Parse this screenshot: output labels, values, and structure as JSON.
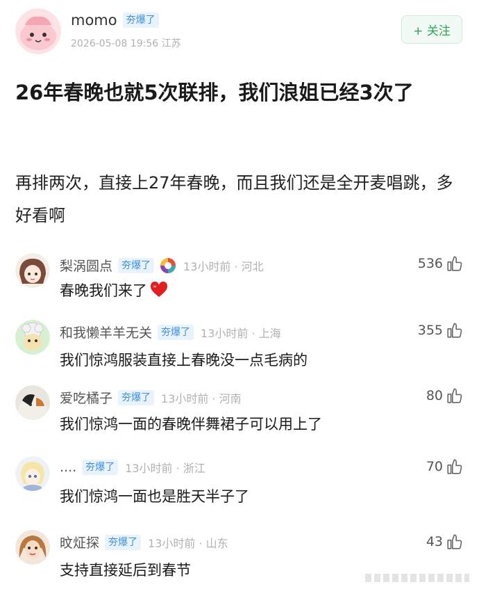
{
  "post": {
    "username": "momo",
    "badge": "夯爆了",
    "meta": "2026-05-08 19:56  江苏",
    "follow_label": "+ 关注",
    "title": "26年春晚也就5次联排，我们浪姐已经3次了",
    "content": "再排两次，直接上27年春晚，而且我们还是全开麦唱跳，多好看啊"
  },
  "comments": [
    {
      "name": "梨涡圆点",
      "badge": "夯爆了",
      "meta": "13小时前 · 河北",
      "likes": "536",
      "text": "春晚我们来了"
    },
    {
      "name": "和我懒羊羊无关",
      "badge": "夯爆了",
      "meta": "13小时前 · 上海",
      "likes": "355",
      "text": "我们惊鸿服装直接上春晚没一点毛病的"
    },
    {
      "name": "爱吃橘子",
      "badge": "夯爆了",
      "meta": "13小时前 · 河南",
      "likes": "80",
      "text": "我们惊鸿一面的春晚伴舞裙子可以用上了"
    },
    {
      "name": "....",
      "badge": "夯爆了",
      "meta": "13小时前 · 浙江",
      "likes": "70",
      "text": "我们惊鸿一面也是胜天半子了"
    },
    {
      "name": "旼炡探",
      "badge": "夯爆了",
      "meta": "13小时前 · 山东",
      "likes": "43",
      "text": "支持直接延后到春节"
    }
  ],
  "colors": {
    "badge_bg": "#e8f3fd",
    "badge_text": "#3f8fd9",
    "follow_green": "#2fa558",
    "meta_gray": "#b1b1b1",
    "heart_red": "#e02020"
  },
  "icons": {
    "like": "thumbs-up-icon",
    "heart": "heart-emoji-icon",
    "medal": "colorful-medal-icon"
  }
}
